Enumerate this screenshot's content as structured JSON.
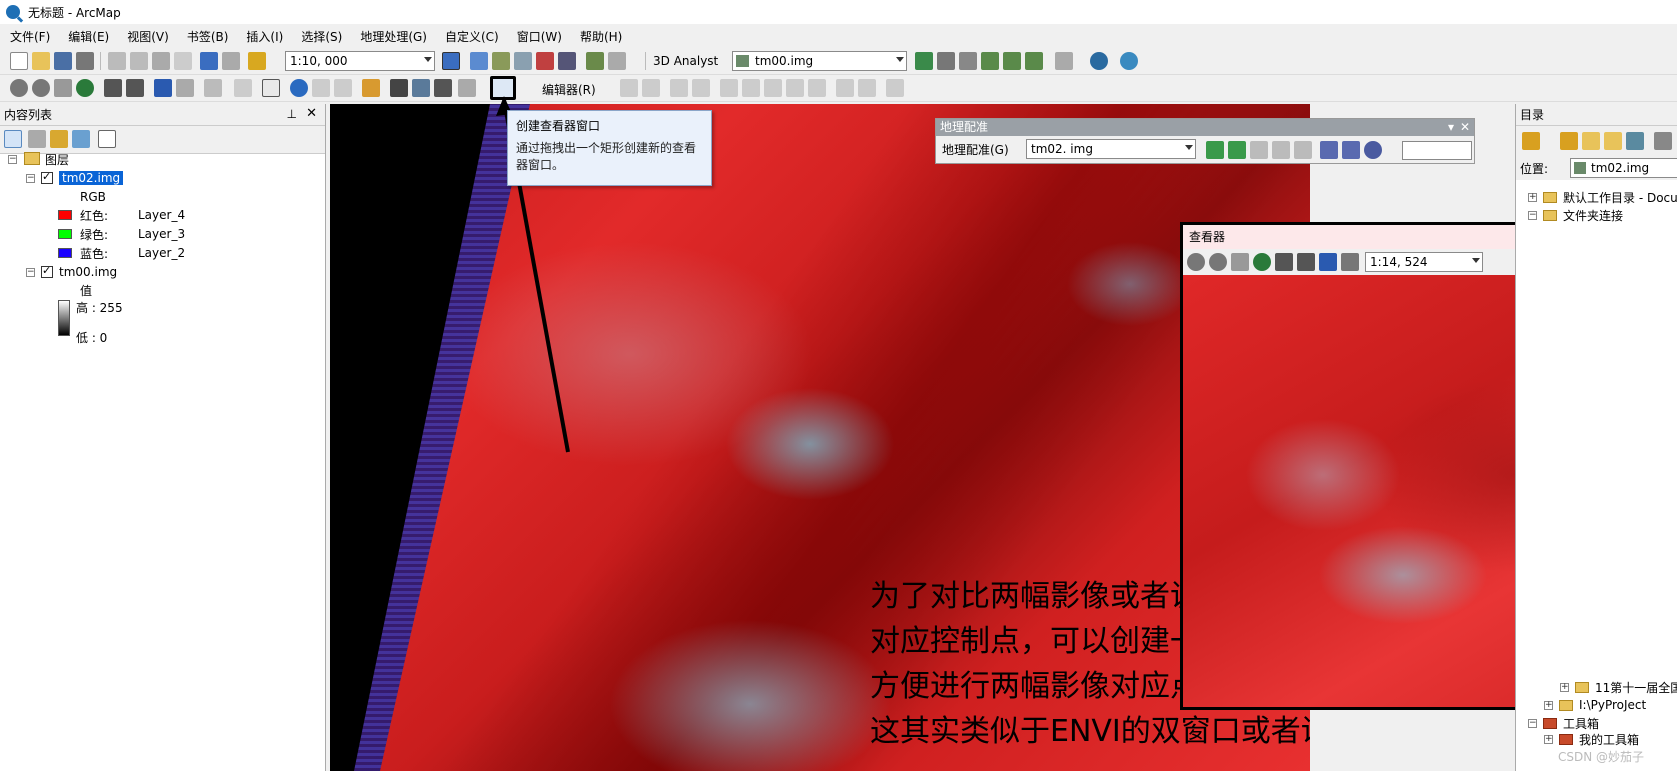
{
  "window": {
    "title": "无标题 - ArcMap"
  },
  "menu": [
    "文件(F)",
    "编辑(E)",
    "视图(V)",
    "书签(B)",
    "插入(I)",
    "选择(S)",
    "地理处理(G)",
    "自定义(C)",
    "窗口(W)",
    "帮助(H)"
  ],
  "toolbar1": {
    "scale": "1:10, 000",
    "analyst_label": "3D Analyst",
    "layer_combo": "tm00.img"
  },
  "toolbar2": {
    "editor_label": "编辑器(R)"
  },
  "toc": {
    "title": "内容列表",
    "root": "图层",
    "layer1": {
      "name": "tm02.img",
      "renderer": "RGB",
      "bands": [
        {
          "label": "红色:",
          "value": "Layer_4",
          "color": "#ff0000"
        },
        {
          "label": "绿色:",
          "value": "Layer_3",
          "color": "#00ff00"
        },
        {
          "label": "蓝色:",
          "value": "Layer_2",
          "color": "#0000ff"
        }
      ]
    },
    "layer2": {
      "name": "tm00.img",
      "value_label": "值",
      "high": "高 : 255",
      "low": "低 : 0"
    }
  },
  "tooltip": {
    "title": "创建查看器窗口",
    "desc_line1": "通过拖拽出一个矩形创建新的查看",
    "desc_line2": "器窗口。"
  },
  "georef": {
    "title": "地理配准",
    "menu_label": "地理配准(G)",
    "layer": "tm02. img"
  },
  "viewer": {
    "title": "查看器",
    "scale": "1:14, 524",
    "close": "×"
  },
  "annotation": {
    "line1": "为了对比两幅影像或者说我们后面找到",
    "line2": "对应控制点，可以创建一个查看器窗口",
    "line3": "方便进行两幅影像对应点的查找（",
    "line4": "这其实类似于ENVI的双窗口或者说鹰眼图)"
  },
  "catalog": {
    "title": "目录",
    "location_label": "位置:",
    "location_value": "tm02.img",
    "items": [
      "默认工作目录 - Docu",
      "文件夹连接",
      "11第十一届全国",
      "I:\\PyProJect",
      "工具箱",
      "我的工具箱"
    ]
  },
  "watermark": "CSDN @妙茄子"
}
